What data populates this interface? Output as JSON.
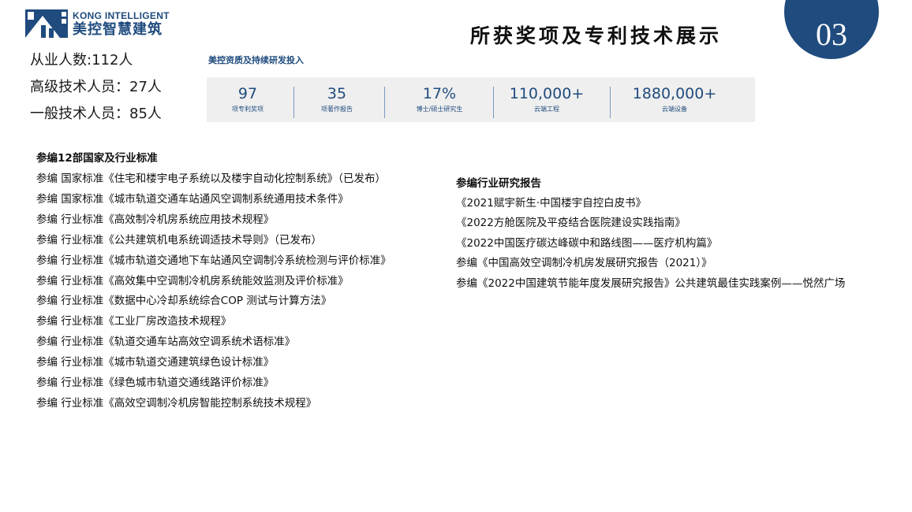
{
  "logo": {
    "en": "KONG INTELLIGENT",
    "cn": "美控智慧建筑",
    "color": "#1f4b7e"
  },
  "title": "所获奖项及专利技术展示",
  "page_number": "03",
  "staff": [
    "从业人数:112人",
    "高级技术人员：27人",
    "一般技术人员：85人"
  ],
  "stats": {
    "title": "美控资质及持续研发投入",
    "items": [
      {
        "value": "97",
        "label": "项专利奖项"
      },
      {
        "value": "35",
        "label": "项著作报告"
      },
      {
        "value": "17%",
        "label": "博士/硕士研究生"
      },
      {
        "value": "110,000+",
        "label": "云端工程"
      },
      {
        "value": "1880,000+",
        "label": "云端设备"
      }
    ]
  },
  "standards": {
    "heading": "参编12部国家及行业标准",
    "items": [
      "参编 国家标准《住宅和楼宇电子系统以及楼宇自动化控制系统》（已发布）",
      "参编 国家标准《城市轨道交通车站通风空调制系统通用技术条件》",
      "参编 行业标准《高效制冷机房系统应用技术规程》",
      "参编 行业标准《公共建筑机电系统调适技术导则》（已发布）",
      "参编 行业标准《城市轨道交通地下车站通风空调制冷系统检测与评价标准》",
      "参编 行业标准《高效集中空调制冷机房系统能效监测及评价标准》",
      "参编 行业标准《数据中心冷却系统综合COP 测试与计算方法》",
      "参编 行业标准《工业厂房改造技术规程》",
      "参编 行业标准《轨道交通车站高效空调系统术语标准》",
      "参编 行业标准《城市轨道交通建筑绿色设计标准》",
      "参编 行业标准《绿色城市轨道交通线路评价标准》",
      "参编 行业标准《高效空调制冷机房智能控制系统技术规程》"
    ]
  },
  "reports": {
    "heading": "参编行业研究报告",
    "items": [
      "《2021赋宇新生·中国楼宇自控白皮书》",
      "《2022方舱医院及平疫结合医院建设实践指南》",
      "《2022中国医疗碳达峰碳中和路线图——医疗机构篇》",
      "参编《中国高效空调制冷机房发展研究报告（2021）》",
      "参编《2022中国建筑节能年度发展研究报告》公共建筑最佳实践案例——悦然广场"
    ]
  }
}
